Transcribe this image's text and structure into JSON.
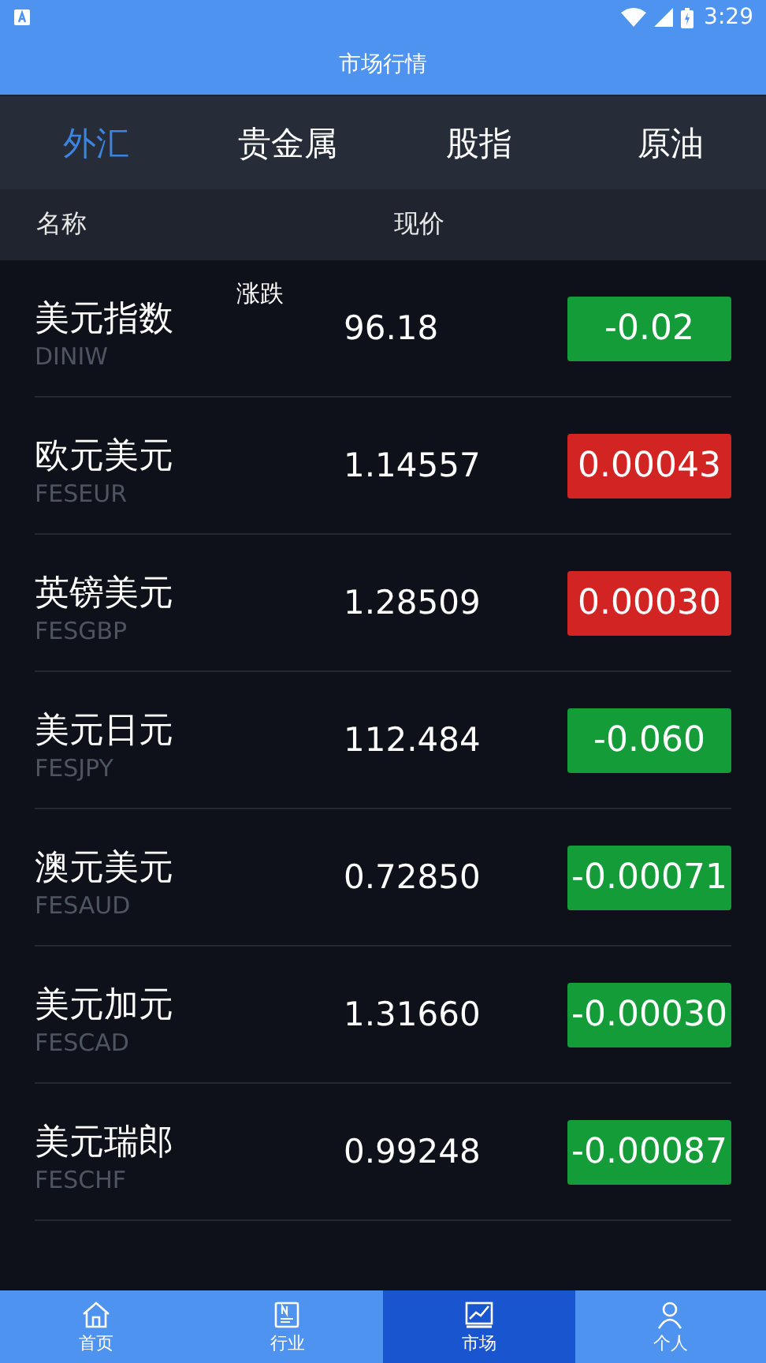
{
  "status_bar": {
    "time": "3:29"
  },
  "title": "市场行情",
  "tabs": [
    {
      "label": "外汇",
      "selected": true
    },
    {
      "label": "贵金属",
      "selected": false
    },
    {
      "label": "股指",
      "selected": false
    },
    {
      "label": "原油",
      "selected": false
    }
  ],
  "table": {
    "columns": [
      "名称",
      "现价",
      "涨跌"
    ],
    "rows": [
      {
        "name": "美元指数",
        "code": "DINIW",
        "price": "96.18",
        "change": "-0.02",
        "color": "#139c38"
      },
      {
        "name": "欧元美元",
        "code": "FESEUR",
        "price": "1.14557",
        "change": "0.00043",
        "color": "#d32424"
      },
      {
        "name": "英镑美元",
        "code": "FESGBP",
        "price": "1.28509",
        "change": "0.00030",
        "color": "#d32424"
      },
      {
        "name": "美元日元",
        "code": "FESJPY",
        "price": "112.484",
        "change": "-0.060",
        "color": "#139c38"
      },
      {
        "name": "澳元美元",
        "code": "FESAUD",
        "price": "0.72850",
        "change": "-0.00071",
        "color": "#139c38"
      },
      {
        "name": "美元加元",
        "code": "FESCAD",
        "price": "1.31660",
        "change": "-0.00030",
        "color": "#139c38"
      },
      {
        "name": "美元瑞郎",
        "code": "FESCHF",
        "price": "0.99248",
        "change": "-0.00087",
        "color": "#139c38"
      }
    ]
  },
  "bottom_nav": [
    {
      "label": "首页",
      "selected": false
    },
    {
      "label": "行业",
      "selected": false
    },
    {
      "label": "市场",
      "selected": true
    },
    {
      "label": "个人",
      "selected": false
    }
  ]
}
